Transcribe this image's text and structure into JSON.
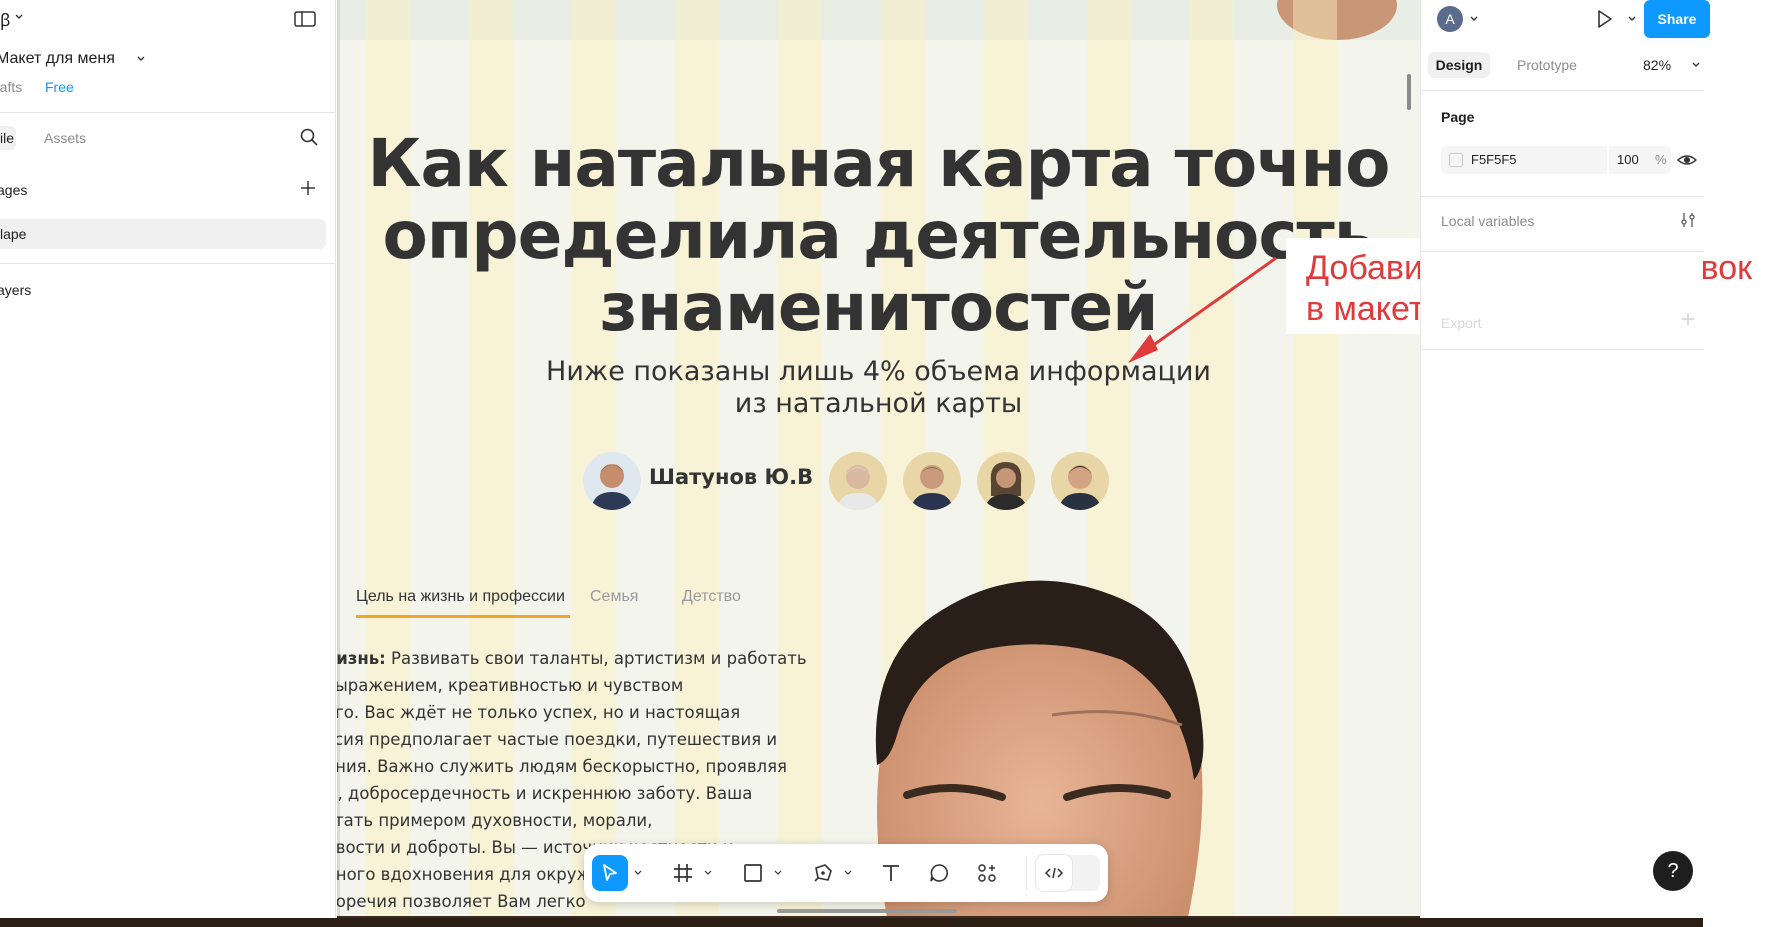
{
  "app": {
    "logo_glyph": "ꞵ",
    "file_title": "Макет для меня",
    "drafts_label": "rafts",
    "plan_badge": "Free"
  },
  "left_panel": {
    "tab_file": "ile",
    "tab_assets": "Assets",
    "pages_label": "ages",
    "page_item": "lape",
    "layers_label": "ayers"
  },
  "canvas": {
    "headline_lines": [
      "Как натальная карта точно",
      "определила деятельность",
      "знаменитостей"
    ],
    "subtitle_lines": [
      "Ниже показаны лишь 4% объема информации",
      "из натальной карты"
    ],
    "person_name": "Шатунов Ю.В",
    "tabs": [
      "Цель на жизнь и профессии",
      "Семья",
      "Детство"
    ],
    "body_lines": [
      "кизнь: Развивать свои таланты, артистизм и работать",
      "выражением, креативностью и чувством",
      "ого. Вас ждёт не только успех, но и настоящая",
      "ссия предполагает частые поездки, путешествия и",
      "ения. Важно служить людям бескорыстно, проявляя",
      "м, добросердечность и искреннюю заботу. Ваша",
      "стать примером духовности, морали,",
      "ивости и доброты. Вы — источник честности и",
      "нного вдохновения для окружающих",
      "норечия позволяет Вам легко"
    ],
    "body_bold_prefix": "кизнь:"
  },
  "annotation": {
    "lines": [
      "Добавить этот подзаголовок",
      "в макете есть"
    ],
    "color": "#e03a3a"
  },
  "right_panel": {
    "user_initial": "A",
    "share_label": "Share",
    "tab_design": "Design",
    "tab_prototype": "Prototype",
    "zoom": "82%",
    "page_label": "Page",
    "page_fill_hex": "F5F5F5",
    "page_fill_opacity": "100",
    "opacity_unit": "%",
    "local_variables": "Local variables",
    "export_label": "Export"
  },
  "help_label": "?",
  "colors": {
    "accent": "#0d99ff",
    "tab_underline": "#f0a528",
    "canvas_bg": "#f3f5ec"
  }
}
